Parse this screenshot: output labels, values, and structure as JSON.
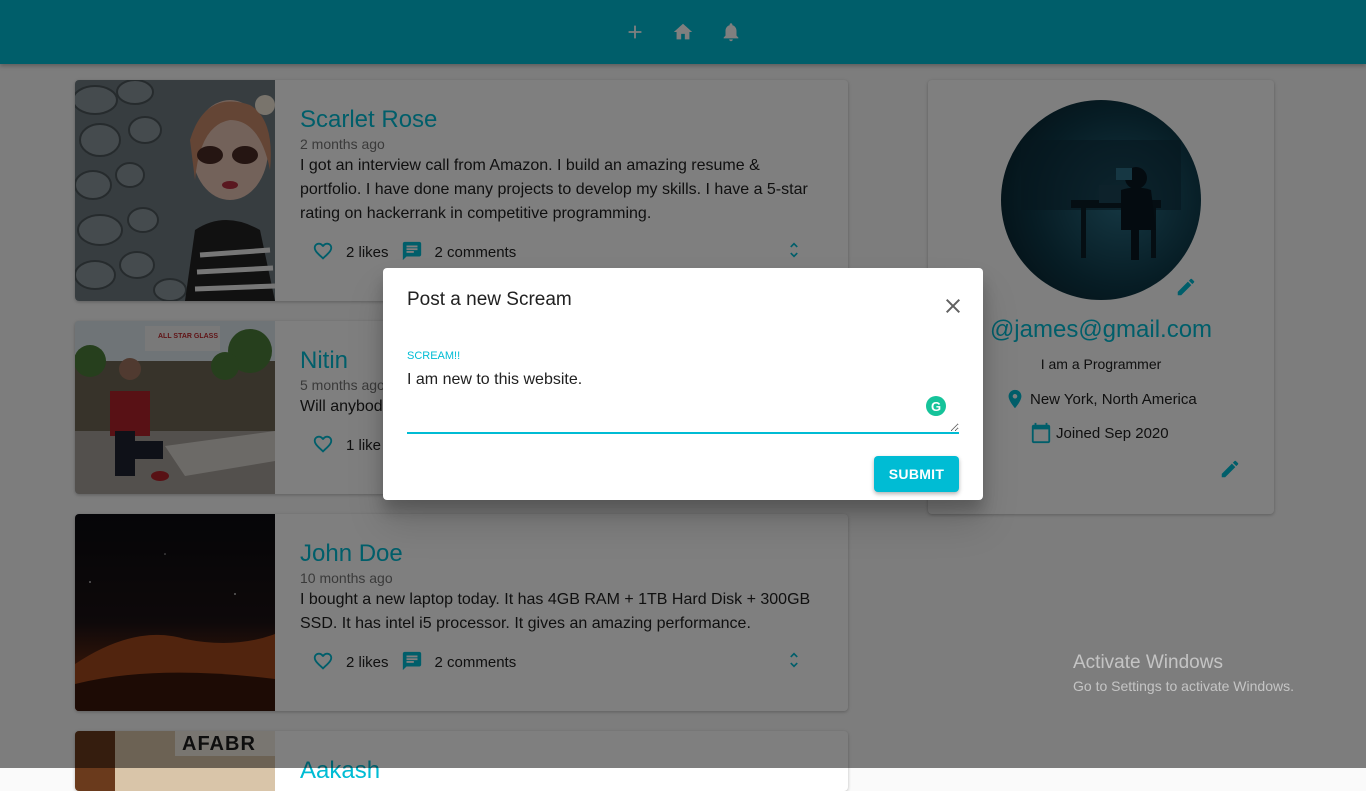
{
  "appbar": {
    "icons": [
      "add-icon",
      "home-icon",
      "notifications-icon"
    ],
    "color": "#00bcd4"
  },
  "screams": [
    {
      "author": "Scarlet Rose",
      "time": "2 months ago",
      "body": "I got an interview call from Amazon. I build an amazing resume & portfolio. I have done many projects to develop my skills. I have a 5-star rating on hackerrank in competitive programming.",
      "likes": "2 likes",
      "comments": "2 comments"
    },
    {
      "author": "Nitin",
      "time": "5 months ago",
      "body": "Will anybod",
      "likes": "1 like",
      "comments": ""
    },
    {
      "author": "John Doe",
      "time": "10 months ago",
      "body": "I bought a new laptop today. It has 4GB RAM + 1TB Hard Disk + 300GB SSD. It has intel i5 processor. It gives an amazing performance.",
      "likes": "2 likes",
      "comments": "2 comments"
    },
    {
      "author": "Aakash",
      "thumb_text": "AFABR"
    }
  ],
  "thumb_sign": "ALL STAR GLASS",
  "profile": {
    "handle": "@james@gmail.com",
    "bio": "I am a Programmer",
    "location": "New York, North America",
    "joined": "Joined Sep 2020"
  },
  "dialog": {
    "title": "Post a new Scream",
    "field_label": "SCREAM!!",
    "field_value": "I am new to this website.",
    "submit_label": "SUBMIT"
  },
  "watermark": {
    "line1": "Activate Windows",
    "line2": "Go to Settings to activate Windows."
  },
  "colors": {
    "primary": "#00bcd4",
    "grammarly": "#15c39a"
  }
}
